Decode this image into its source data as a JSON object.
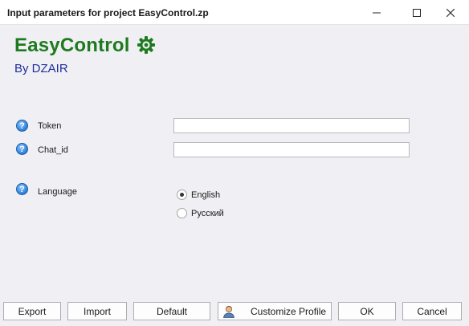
{
  "window": {
    "title": "Input parameters for project EasyControl.zp",
    "controls": [
      "minimize-icon",
      "maximize-icon",
      "close-icon"
    ]
  },
  "header": {
    "app_name": "EasyControl",
    "byline": "By DZAIR",
    "brand_color": "#1e7a1e",
    "byline_color": "#1f2f9c"
  },
  "fields": [
    {
      "label": "Token",
      "value": "",
      "icon": "help-icon"
    },
    {
      "label": "Chat_id",
      "value": "",
      "icon": "help-icon"
    }
  ],
  "language": {
    "label": "Language",
    "icon": "help-icon",
    "options": [
      {
        "label": "English",
        "selected": true
      },
      {
        "label": "Русский",
        "selected": false
      }
    ]
  },
  "buttons": {
    "export": "Export",
    "import": "Import",
    "default": "Default",
    "customize_profile": "Customize Profile",
    "ok": "OK",
    "cancel": "Cancel"
  }
}
